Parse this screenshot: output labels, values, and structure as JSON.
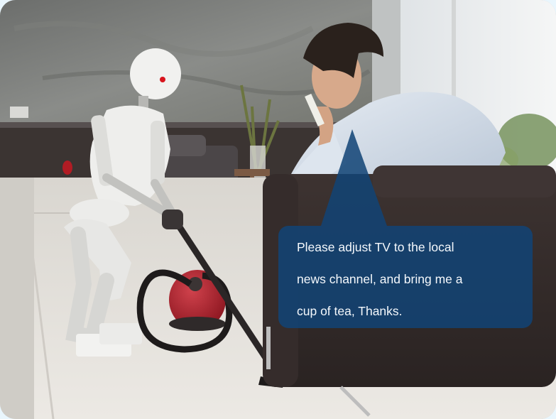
{
  "speech_bubble": {
    "lines": [
      "Please adjust TV to the local",
      "news channel, and bring me a",
      "cup of tea, Thanks."
    ]
  },
  "colors": {
    "frame_background": "#e9f6fd",
    "bubble_fill": "#124476",
    "bubble_text": "#f4f8fc"
  },
  "scene_elements": [
    "concrete-wall",
    "window",
    "humanoid-robot",
    "vacuum-cleaner",
    "man",
    "sofa",
    "floor"
  ]
}
